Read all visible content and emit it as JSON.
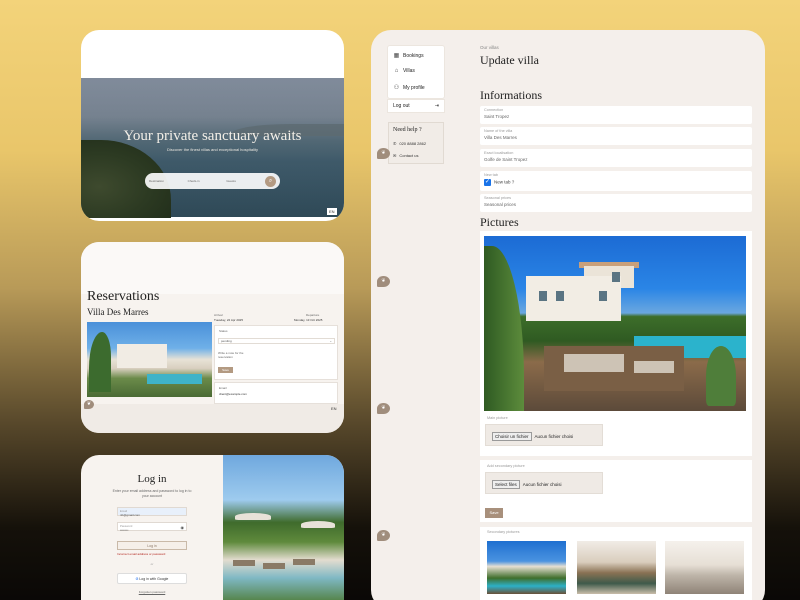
{
  "hero": {
    "title": "Your private sanctuary awaits",
    "subtitle": "Discover the finest villas and exceptional hospitality",
    "search_fields": [
      "Destination",
      "Check-in",
      "Guests"
    ],
    "lang": "EN"
  },
  "reservations": {
    "title": "Reservations",
    "villa": "Villa Des Marres",
    "arrival_label": "Arrival",
    "arrival": "Tuesday, 22 Apr 2025",
    "departure_label": "Departure",
    "departure": "Monday, 13 Oct 2025",
    "form_label": "Status",
    "select_value": "pending",
    "note_placeholder": "Write a note for the reservation",
    "button": "Save",
    "email_label": "Email",
    "email_value": "client@example.com",
    "lang": "EN"
  },
  "login": {
    "title": "Log in",
    "subtitle": "Enter your email address and password to log in to your account",
    "email_label": "Email",
    "email_value": "nb@gmail.com",
    "password_label": "Password",
    "password_value": "••••••••",
    "button": "Log in",
    "error": "Incorrect email address or password",
    "divider": "or",
    "google": "Log in with Google",
    "forgot": "Forgotten password"
  },
  "admin": {
    "nav": [
      {
        "icon": "calendar-icon",
        "glyph": "▦",
        "label": "Bookings"
      },
      {
        "icon": "home-icon",
        "glyph": "⌂",
        "label": "Villas"
      },
      {
        "icon": "user-icon",
        "glyph": "⚇",
        "label": "My profile"
      }
    ],
    "logout": "Log out",
    "help_title": "Need help ?",
    "phone": "020 8888 2862",
    "contact": "Contact us",
    "breadcrumb": "Our villas",
    "page_title": "Update villa",
    "informations_title": "Informations",
    "fields": [
      {
        "label": "Connection",
        "value": "Saint Tropez"
      },
      {
        "label": "Name of the villa",
        "value": "Villa Des Marres"
      },
      {
        "label": "Exact localisation",
        "value": "Golfe de Saint Tropez"
      },
      {
        "label": "New tab",
        "value": "New tab ?",
        "checked": true
      },
      {
        "label": "Seasonal prices",
        "value": "Seasonal prices"
      }
    ],
    "pictures_title": "Pictures",
    "main_picture_label": "Main picture",
    "choose_file": "Choisir un fichier",
    "no_file": "Aucun fichier choisi",
    "additional_label": "Add secondary picture",
    "select_files": "Select files",
    "no_file_2": "Aucun fichier choisi",
    "save": "Save",
    "secondary_label": "Secondary pictures"
  }
}
